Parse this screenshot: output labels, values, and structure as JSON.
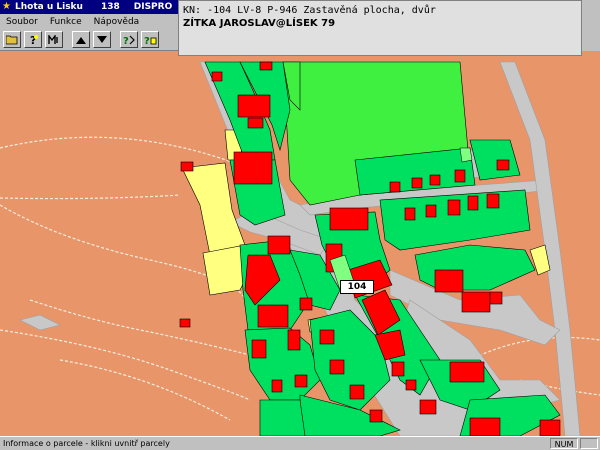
{
  "window": {
    "title": "Lhota u Lisku",
    "code": "138",
    "program": "DISPRO"
  },
  "menu": {
    "items": [
      "Soubor",
      "Funkce",
      "Nápověda"
    ]
  },
  "toolbar": {
    "icons": [
      "open-folder-icon",
      "help-icon",
      "zoom-icon",
      "zoom-in-icon",
      "zoom-out-icon",
      "info-query-icon",
      "info-query-2-icon"
    ]
  },
  "info_panel": {
    "line1": "KN: -104  LV-8  P-946  Zastavěná plocha, dvůr",
    "line2": "ZÍTKA JAROSLAV@LÍSEK 79"
  },
  "map": {
    "selected_parcel_label": "104",
    "colors": {
      "arable": "#e8956a",
      "garden": "#00e060",
      "meadow": "#40f040",
      "building": "#ff0000",
      "road": "#c8c8c8",
      "other": "#ffff80"
    }
  },
  "status": {
    "message": "Informace o parcele - klikni uvnitř parcely",
    "mode": "NUM"
  }
}
